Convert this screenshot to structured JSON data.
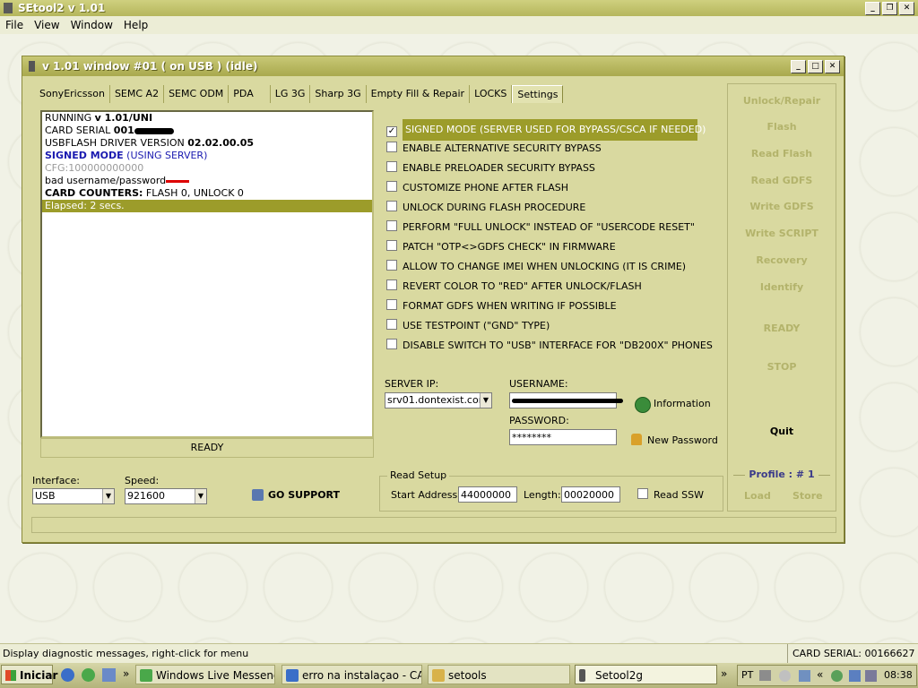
{
  "app": {
    "title": "SEtool2 v 1.01"
  },
  "menu": [
    "File",
    "View",
    "Window",
    "Help"
  ],
  "child": {
    "title": "v 1.01 window #01 ( on USB ) (idle)"
  },
  "tabs": [
    "SonyEricsson",
    "SEMC A2",
    "SEMC ODM",
    "PDA",
    "LG 3G",
    "Sharp 3G",
    "Empty Fill & Repair",
    "LOCKS",
    "Settings"
  ],
  "active_tab": "Settings",
  "log": {
    "lines": [
      {
        "a": "RUNNING ",
        "b": "v 1.01/UNI"
      },
      {
        "a": "CARD SERIAL ",
        "b": "001"
      },
      {
        "a": "USBFLASH DRIVER VERSION ",
        "b": "02.02.00.05"
      },
      {
        "a": "SIGNED MODE",
        "b": " (USING SERVER)"
      },
      {
        "a": "CFG:",
        "b": "100000000000"
      },
      {
        "a": "bad username/password",
        "b": ""
      },
      {
        "a": "CARD COUNTERS:",
        "b": " FLASH 0, UNLOCK 0"
      },
      {
        "a": "Elapsed: 2 secs.",
        "b": ""
      }
    ],
    "ready": "READY"
  },
  "options": [
    {
      "label": "SIGNED MODE (SERVER USED FOR BYPASS/CSCA IF NEEDED)",
      "checked": true
    },
    {
      "label": "ENABLE ALTERNATIVE SECURITY BYPASS",
      "checked": false
    },
    {
      "label": "ENABLE PRELOADER SECURITY BYPASS",
      "checked": false
    },
    {
      "label": "CUSTOMIZE PHONE AFTER FLASH",
      "checked": false
    },
    {
      "label": "UNLOCK DURING FLASH PROCEDURE",
      "checked": false
    },
    {
      "label": "PERFORM \"FULL UNLOCK\" INSTEAD OF \"USERCODE RESET\"",
      "checked": false
    },
    {
      "label": "PATCH \"OTP<>GDFS CHECK\" IN FIRMWARE",
      "checked": false
    },
    {
      "label": "ALLOW TO CHANGE IMEI WHEN UNLOCKING (IT IS CRIME)",
      "checked": false
    },
    {
      "label": "REVERT COLOR TO \"RED\" AFTER UNLOCK/FLASH",
      "checked": false
    },
    {
      "label": "FORMAT GDFS WHEN WRITING IF POSSIBLE",
      "checked": false
    },
    {
      "label": "USE TESTPOINT (\"GND\" TYPE)",
      "checked": false
    },
    {
      "label": "DISABLE SWITCH TO \"USB\" INTERFACE FOR \"DB200X\" PHONES",
      "checked": false
    }
  ],
  "server": {
    "ip_label": "SERVER IP:",
    "ip_value": "srv01.dontexist.com",
    "username_label": "USERNAME:",
    "password_label": "PASSWORD:",
    "password_value": "********",
    "information": "Information",
    "new_password": "New Password"
  },
  "actions": [
    "Unlock/Repair",
    "Flash",
    "Read Flash",
    "Read GDFS",
    "Write GDFS",
    "Write SCRIPT",
    "Recovery",
    "Identify",
    "READY",
    "STOP",
    "Quit"
  ],
  "profile": {
    "label": "Profile : # 1",
    "load": "Load",
    "store": "Store"
  },
  "interface": {
    "label": "Interface:",
    "value": "USB"
  },
  "speed": {
    "label": "Speed:",
    "value": "921600"
  },
  "go_support": "GO SUPPORT",
  "read_setup": {
    "title": "Read Setup",
    "start_label": "Start Address:",
    "start_value": "44000000",
    "length_label": "Length:",
    "length_value": "00020000",
    "ssw_label": "Read SSW"
  },
  "statusbar": {
    "message": "Display diagnostic messages, right-click for menu",
    "card_serial": "CARD SERIAL: 00166627"
  },
  "taskbar": {
    "start": "Iniciar",
    "tasks": [
      "Windows Live Messenger",
      "erro na instalaçao - CARD...",
      "setools",
      "Setool2g"
    ],
    "lang": "PT",
    "clock": "08:38"
  }
}
